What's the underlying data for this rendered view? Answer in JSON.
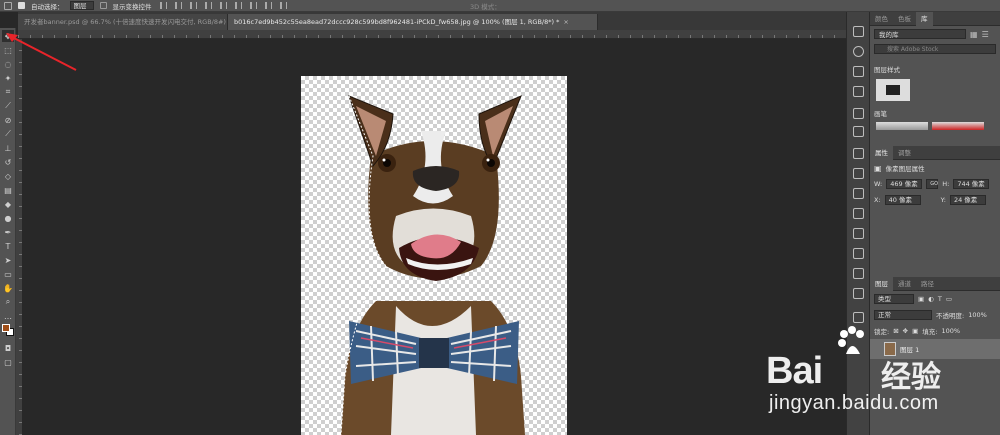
{
  "options_bar": {
    "auto_select_label": "自动选择：",
    "auto_select_target": "图层",
    "show_transform_label": "显示变换控件",
    "mode_3d_label": "3D 模式："
  },
  "tabs": [
    {
      "label": "开发者banner.psd @ 66.7% (十倍速度快速开发闪电交付, RGB/8#) *",
      "close": "×"
    },
    {
      "label": "b016c7ed9b452c55ea8ead72dccc928c599bd8f962481-iPCkD_fw658.jpg @ 100% (图层 1, RGB/8*) *",
      "close": "×"
    }
  ],
  "right_panel": {
    "top_tabs": [
      "颜色",
      "色板",
      "库"
    ],
    "library_select": "我的库",
    "library_search_placeholder": "搜索 Adobe Stock",
    "layer_styles_header": "图层样式",
    "brushes_header": "画笔",
    "properties_tabs": [
      "属性",
      "调整"
    ],
    "properties_title": "像素图层属性",
    "w_label": "W:",
    "w_value": "469 像素",
    "h_label": "H:",
    "h_value": "744 像素",
    "x_label": "X:",
    "x_value": "40 像素",
    "y_label": "Y:",
    "y_value": "24 像素",
    "go_label": "GO",
    "layers_tabs": [
      "图层",
      "通道",
      "路径"
    ],
    "layers_filter": "类型",
    "blend_mode": "正常",
    "opacity_label": "不透明度:",
    "opacity_value": "100%",
    "lock_label": "锁定:",
    "fill_label": "填充:",
    "fill_value": "100%",
    "layer_name": "图层 1"
  },
  "watermark": {
    "brand": "Bai",
    "brand_tail": "经验",
    "url": "jingyan.baidu.com"
  },
  "colors": {
    "foreground": "#a04e18",
    "background": "#ffffff",
    "annotation_arrow": "#e8242a"
  }
}
